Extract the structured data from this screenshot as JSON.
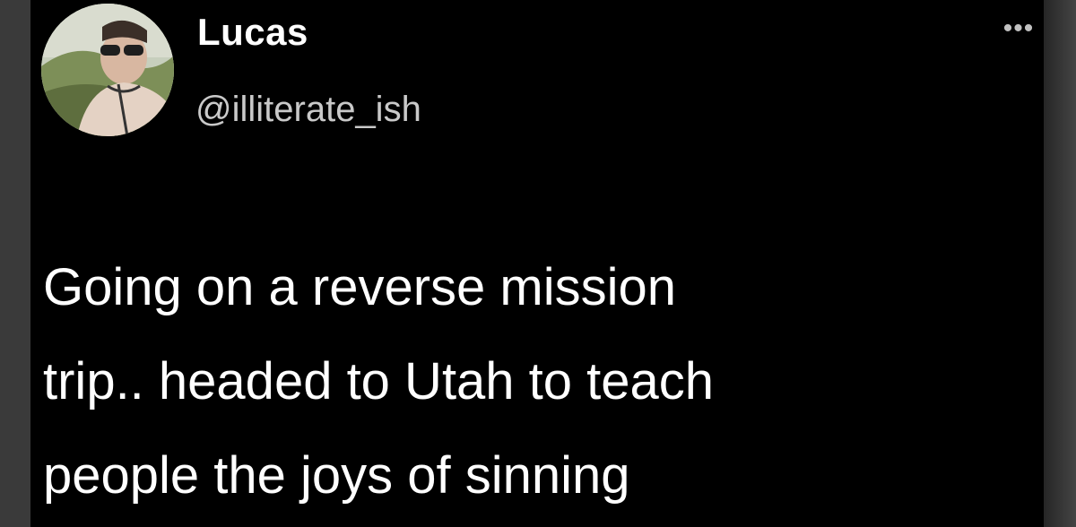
{
  "tweet": {
    "display_name": "Lucas",
    "handle": "@illiterate_ish",
    "more_icon": "more-dots-icon",
    "more_label": "•••",
    "text_lines": [
      "Going on a reverse mission",
      "trip.. headed to Utah to teach",
      "people the joys of sinning"
    ]
  },
  "colors": {
    "background": "#000000",
    "text_primary": "#ffffff",
    "text_secondary": "#c9c9c9"
  }
}
